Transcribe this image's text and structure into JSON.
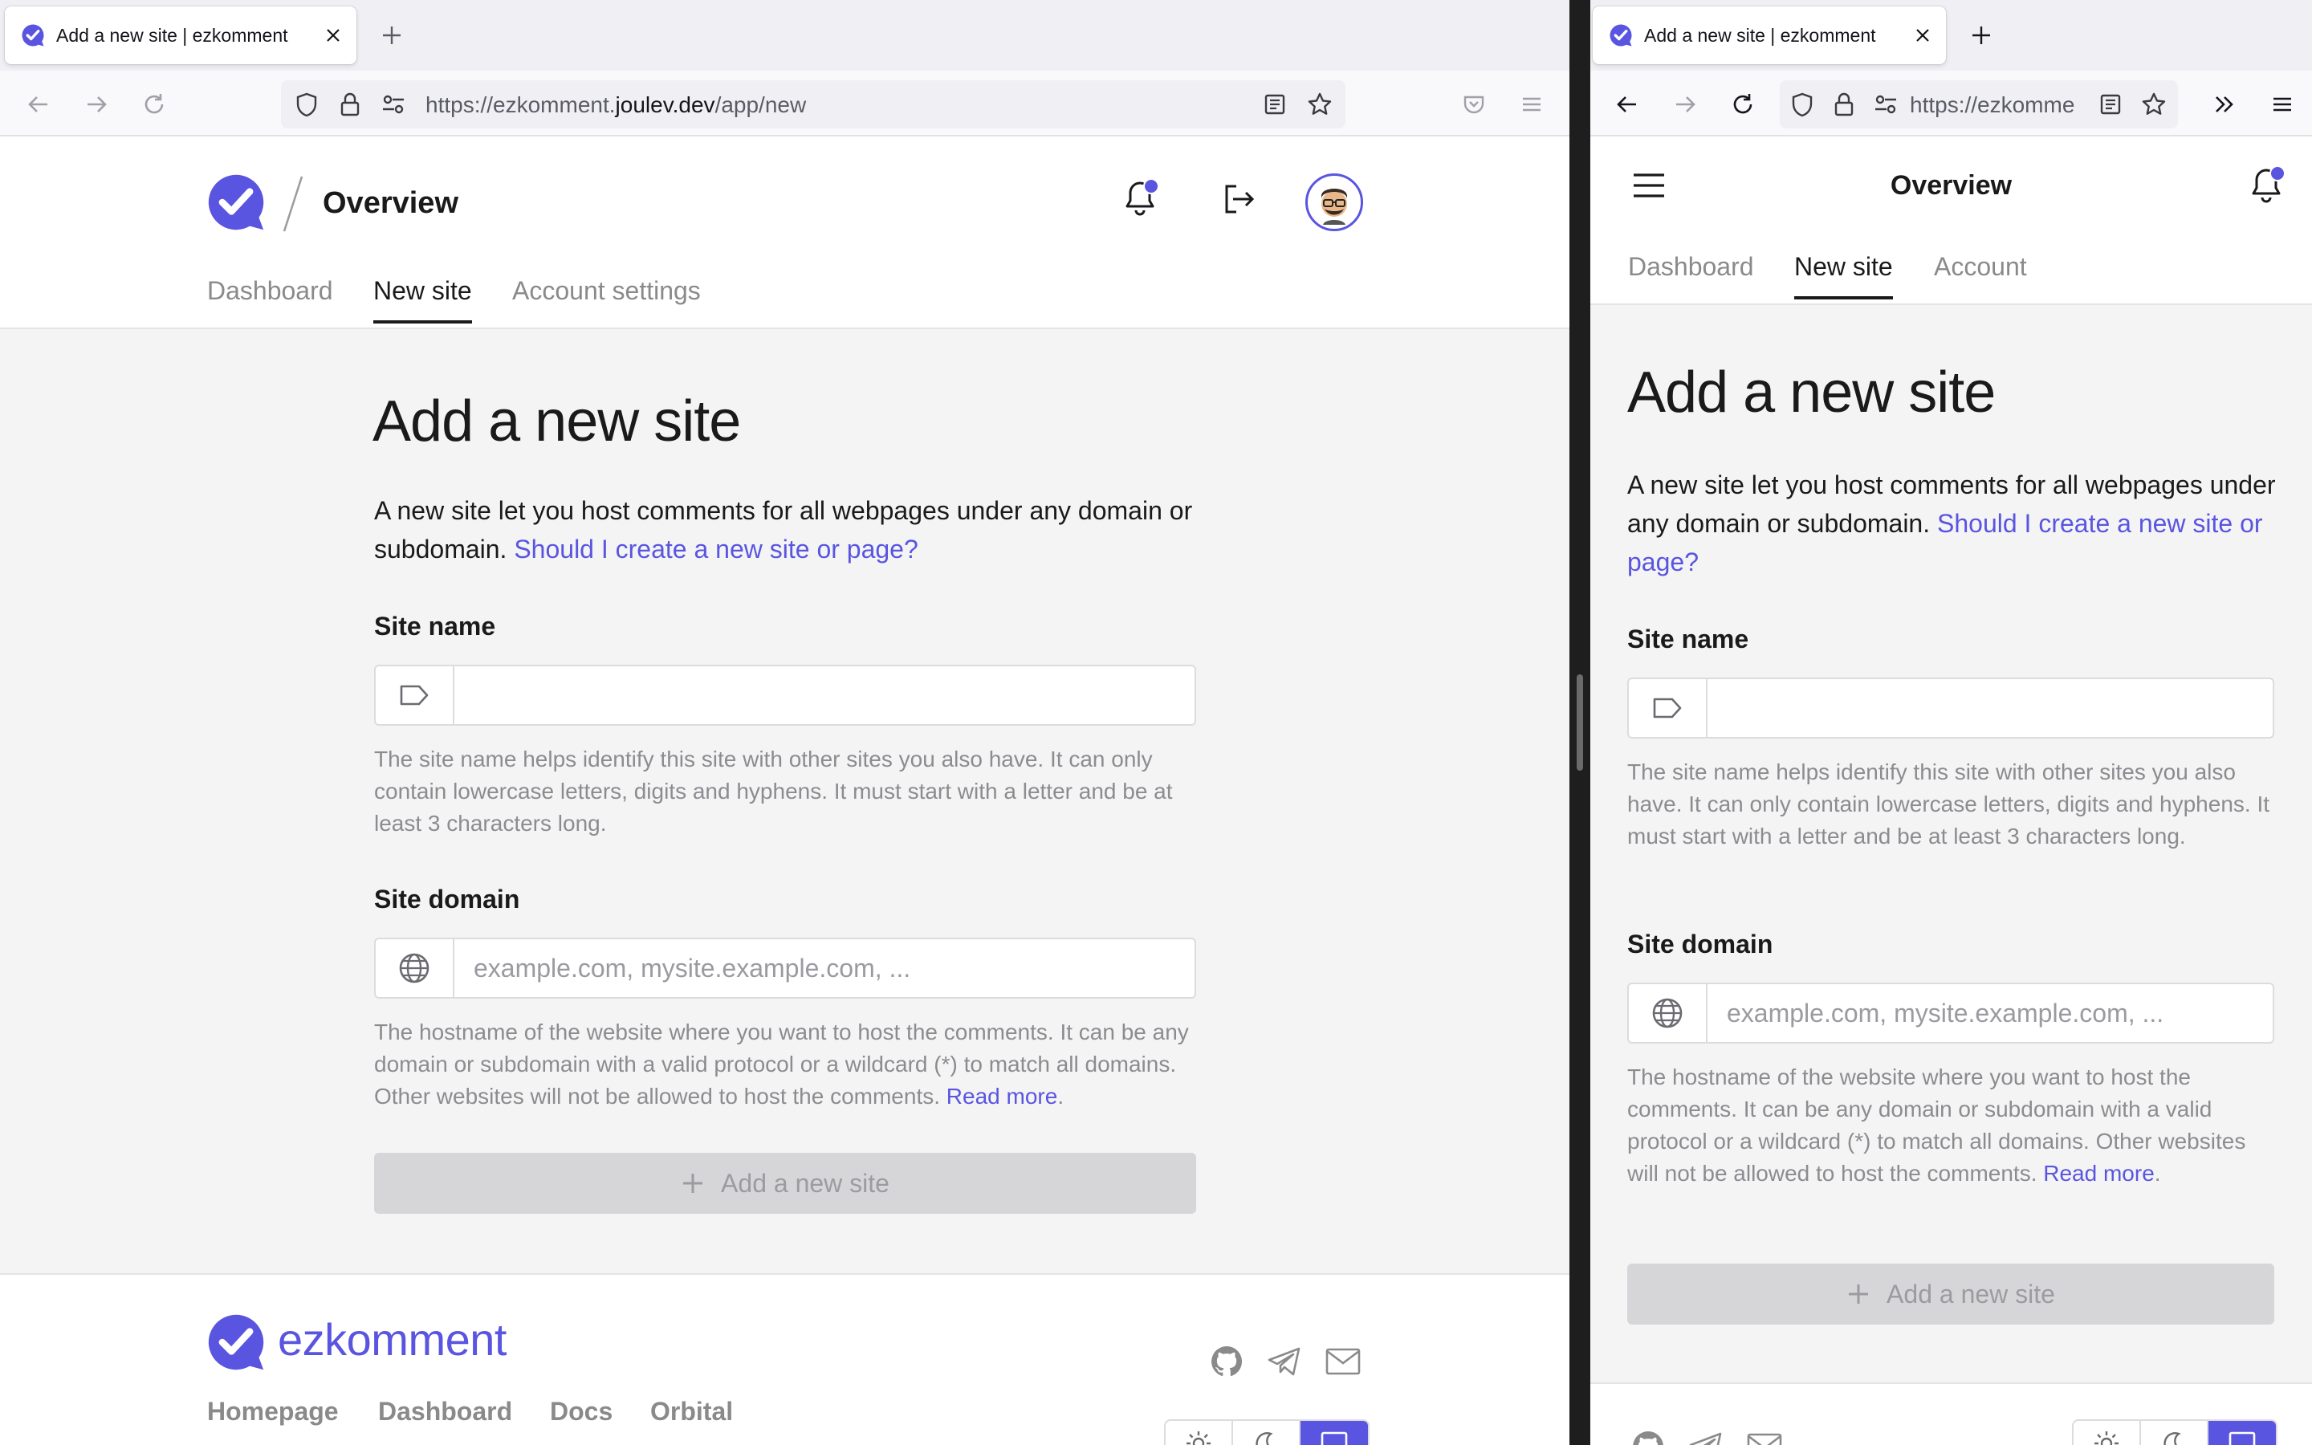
{
  "browser": {
    "tab_title": "Add a new site | ezkomment",
    "url_prefix": "https://ezkomment.",
    "url_domain": "joulev.dev",
    "url_path": "/app/new",
    "url_short": "https://ezkomme"
  },
  "app": {
    "brand": "ezkomment",
    "header_title": "Overview",
    "tabs": [
      "Dashboard",
      "New site",
      "Account settings"
    ],
    "tabs_mobile": [
      "Dashboard",
      "New site",
      "Account"
    ],
    "accent_color": "#5a55e0"
  },
  "form": {
    "heading": "Add a new site",
    "intro": "A new site let you host comments for all webpages under any domain or subdomain.",
    "intro_link": "Should I create a new site or page?",
    "site_name": {
      "label": "Site name",
      "value": "",
      "help": "The site name helps identify this site with other sites you also have. It can only contain lowercase letters, digits and hyphens. It must start with a letter and be at least 3 characters long."
    },
    "site_domain": {
      "label": "Site domain",
      "placeholder": "example.com, mysite.example.com, ...",
      "help": "The hostname of the website where you want to host the comments. It can be any domain or subdomain with a valid protocol or a wildcard (*) to match all domains. Other websites will not be allowed to host the comments.",
      "read_more": "Read more",
      "period": "."
    },
    "submit_label": "Add a new site"
  },
  "footer": {
    "links": [
      "Homepage",
      "Dashboard",
      "Docs",
      "Orbital"
    ],
    "social_icons": [
      "github-icon",
      "telegram-icon",
      "mail-icon"
    ],
    "theme_options": [
      "light",
      "dark",
      "system"
    ],
    "theme_selected": "system"
  }
}
